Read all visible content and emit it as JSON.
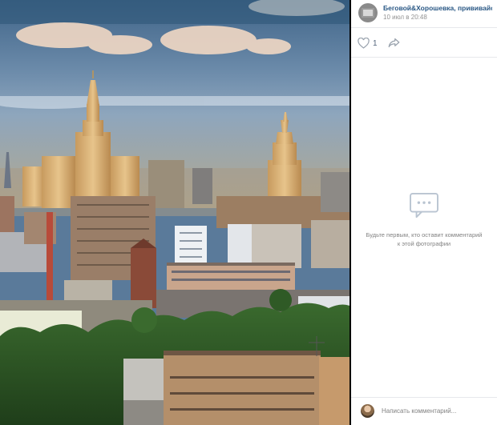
{
  "post": {
    "author": "Беговой&Хорошевка, прививайся!",
    "date": "10 июл в 20:48",
    "likes": "1"
  },
  "comments": {
    "empty_text": "Будьте первым, кто оставит комментарий к этой фотографии",
    "input_placeholder": "Написать комментарий..."
  },
  "icons": {
    "like": "heart-icon",
    "share": "share-arrow-icon",
    "empty_comments": "chat-bubble-icon"
  },
  "colors": {
    "link": "#2a5885",
    "muted": "#939393",
    "icon": "#99a2ad"
  }
}
